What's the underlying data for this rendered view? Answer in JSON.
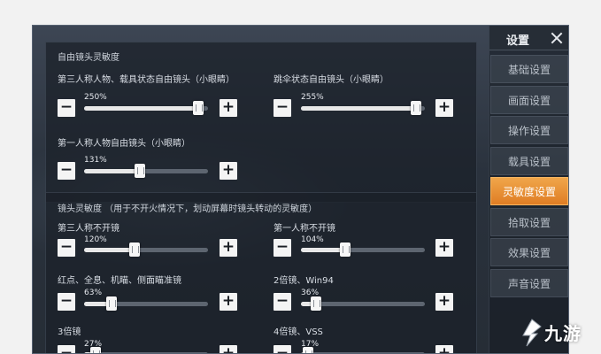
{
  "panels": {
    "free_camera": {
      "title": "自由镜头灵敏度",
      "settings": [
        {
          "label": "第三人称人物、载具状态自由镜头（小眼睛）",
          "value": "250%",
          "fraction": 0.92
        },
        {
          "label": "跳伞状态自由镜头（小眼睛）",
          "value": "255%",
          "fraction": 0.93
        },
        {
          "label": "第一人称人物自由镜头（小眼睛）",
          "value": "131%",
          "fraction": 0.45
        }
      ]
    },
    "camera": {
      "title": "镜头灵敏度 （用于不开火情况下，划动屏幕时镜头转动的灵敏度）",
      "settings": [
        {
          "label": "第三人称不开镜",
          "value": "120%",
          "fraction": 0.41
        },
        {
          "label": "第一人称不开镜",
          "value": "104%",
          "fraction": 0.36
        },
        {
          "label": "红点、全息、机瞄、侧面瞄准镜",
          "value": "63%",
          "fraction": 0.22
        },
        {
          "label": "2倍镜、Win94",
          "value": "36%",
          "fraction": 0.12
        },
        {
          "label": "3倍镜",
          "value": "27%",
          "fraction": 0.09
        },
        {
          "label": "4倍镜、VSS",
          "value": "17%",
          "fraction": 0.06
        }
      ]
    }
  },
  "buttons": {
    "minus": "−",
    "plus": "+"
  },
  "sidebar": {
    "title": "设置",
    "items": [
      {
        "label": "基础设置",
        "active": false
      },
      {
        "label": "画面设置",
        "active": false
      },
      {
        "label": "操作设置",
        "active": false
      },
      {
        "label": "载具设置",
        "active": false
      },
      {
        "label": "灵敏度设置",
        "active": true
      },
      {
        "label": "拾取设置",
        "active": false
      },
      {
        "label": "效果设置",
        "active": false
      },
      {
        "label": "声音设置",
        "active": false
      }
    ]
  },
  "watermark": {
    "text": "九游"
  },
  "colors": {
    "accent": "#e88a2c",
    "panel": "#1a2028",
    "text": "#d9dee5"
  },
  "icons": [
    "close-icon",
    "minus-icon",
    "plus-icon",
    "jiuyou-logo-icon"
  ]
}
